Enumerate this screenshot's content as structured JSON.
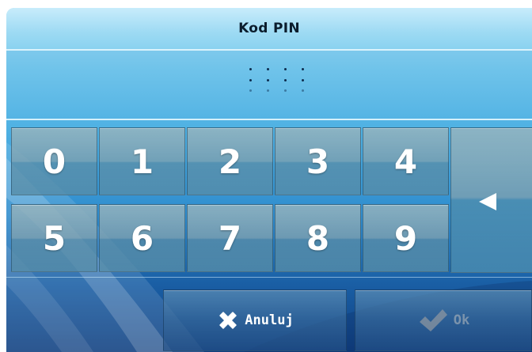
{
  "dialog": {
    "title": "Kod PIN"
  },
  "keypad": {
    "keys": [
      "0",
      "1",
      "2",
      "3",
      "4",
      "5",
      "6",
      "7",
      "8",
      "9"
    ],
    "backspace_icon": "backspace-arrow-icon"
  },
  "actions": {
    "cancel_label": "Anuluj",
    "cancel_icon": "close-x-icon",
    "ok_label": "Ok",
    "ok_icon": "checkmark-icon",
    "ok_enabled": false
  },
  "colors": {
    "title_bar": "#9ddaf3",
    "key_text": "#ffffff",
    "pin_dot": "#0c2b4d"
  }
}
